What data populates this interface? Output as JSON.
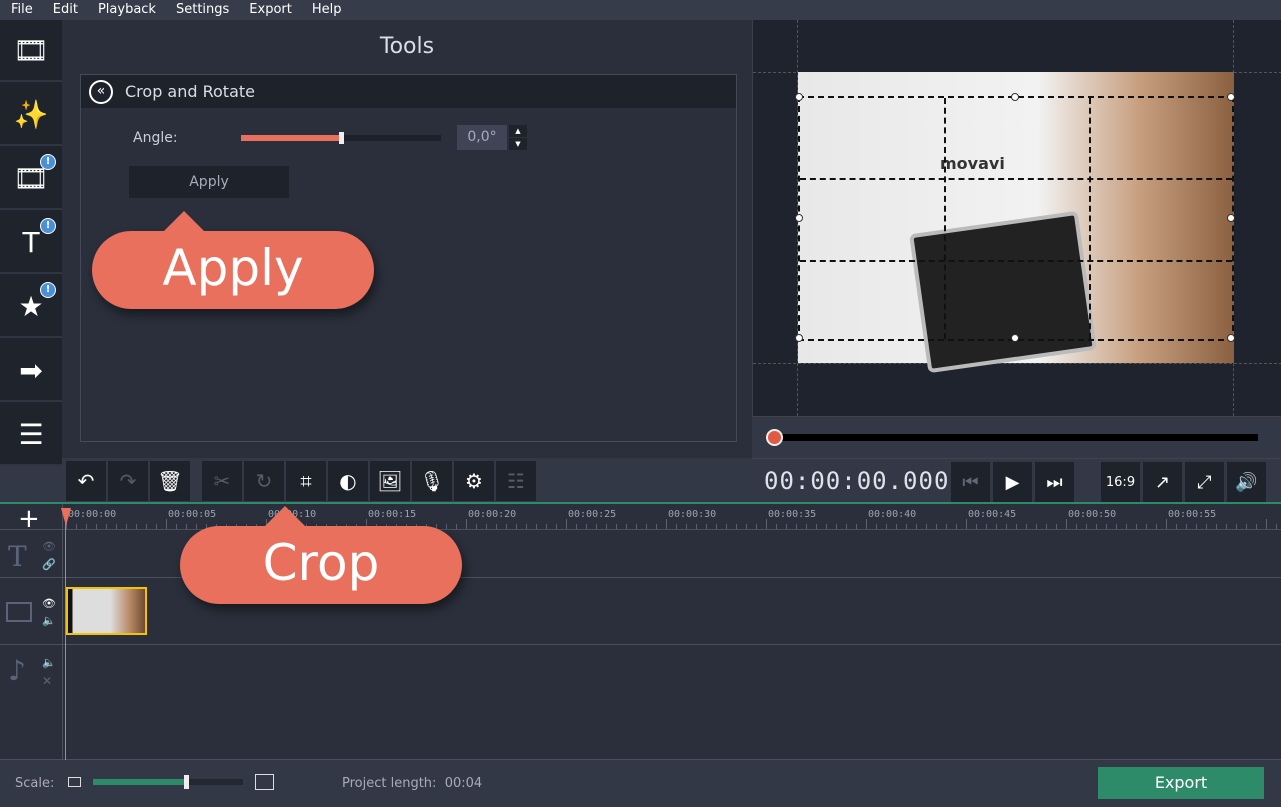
{
  "menu": [
    "File",
    "Edit",
    "Playback",
    "Settings",
    "Export",
    "Help"
  ],
  "sidebar": {
    "items": [
      {
        "icon": "media-file-icon",
        "badge": ""
      },
      {
        "icon": "magic-wand-icon",
        "badge": ""
      },
      {
        "icon": "transitions-icon",
        "badge": "!"
      },
      {
        "icon": "titles-icon",
        "badge": "!"
      },
      {
        "icon": "stickers-icon",
        "badge": "!"
      },
      {
        "icon": "callouts-icon",
        "badge": ""
      },
      {
        "icon": "more-tools-icon",
        "badge": ""
      }
    ]
  },
  "tools": {
    "title": "Tools",
    "panel_title": "Crop and Rotate",
    "angle_label": "Angle:",
    "angle_value": "0,0°",
    "angle_slider_percent": 50,
    "apply_label": "Apply"
  },
  "callouts": {
    "apply": "Apply",
    "crop": "Crop"
  },
  "preview": {
    "seek_position_percent": 0,
    "timecode": "00:00:00.000",
    "aspect": "16:9",
    "image_logo": "movavi"
  },
  "toolbar": {
    "buttons": [
      "undo-icon",
      "redo-icon",
      "delete-icon",
      "cut-icon",
      "rotate-icon",
      "crop-icon",
      "color-adjust-icon",
      "image-icon",
      "microphone-icon",
      "settings-gear-icon",
      "equalizer-icon"
    ]
  },
  "timeline": {
    "ruler": [
      "00:00:00",
      "00:00:05",
      "00:00:10",
      "00:00:15",
      "00:00:20",
      "00:00:25",
      "00:00:30",
      "00:00:35",
      "00:00:40",
      "00:00:45",
      "00:00:50",
      "00:00:55"
    ]
  },
  "bottom": {
    "scale_label": "Scale:",
    "scale_percent": 62,
    "project_length_label": "Project length:",
    "project_length": "00:04",
    "export_label": "Export"
  },
  "colors": {
    "accent": "#e8705c",
    "green": "#2e8b6a",
    "badge": "#4a90d9",
    "clip_border": "#f3c200"
  }
}
